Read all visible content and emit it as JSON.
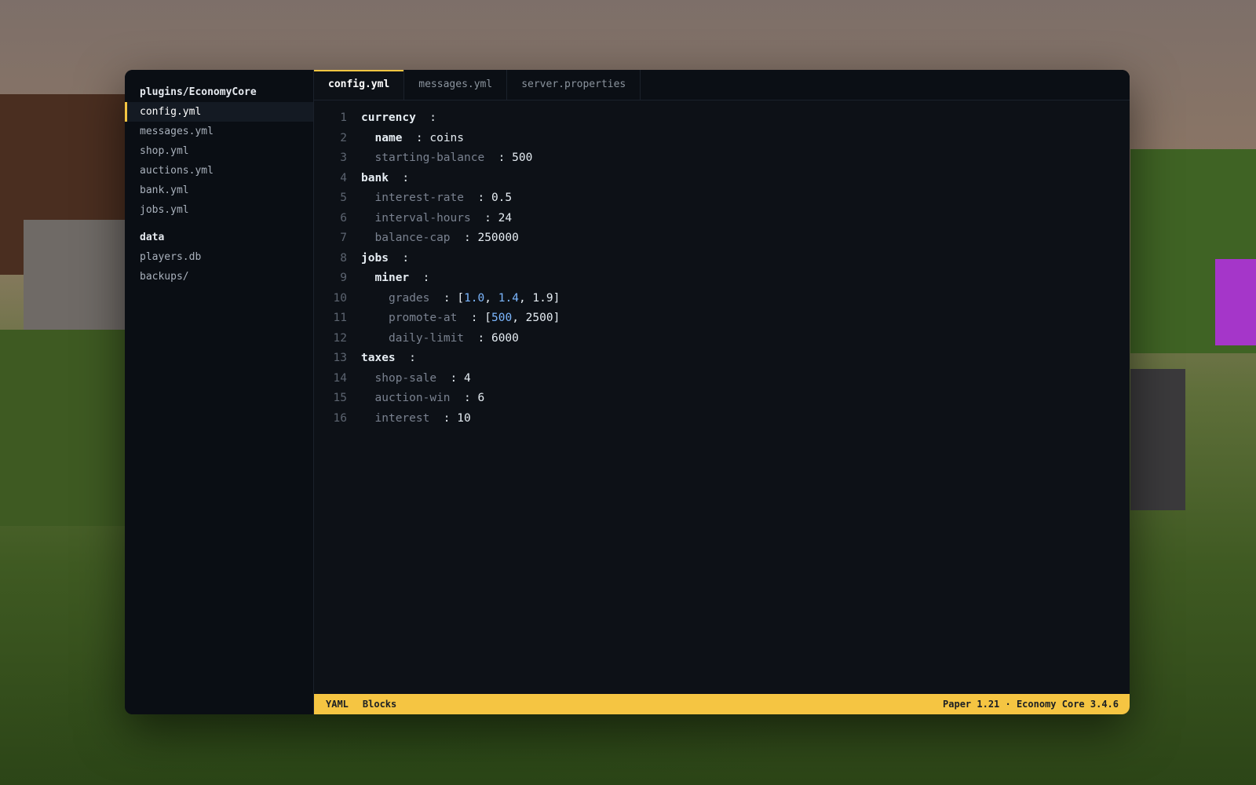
{
  "sidebar": {
    "groups": [
      {
        "title": "plugins/EconomyCore",
        "items": [
          "config.yml",
          "messages.yml",
          "shop.yml",
          "auctions.yml",
          "bank.yml",
          "jobs.yml"
        ]
      },
      {
        "title": "data",
        "items": [
          "players.db",
          "backups/"
        ]
      }
    ]
  },
  "tabs": [
    "config.yml",
    "messages.yml",
    "server.properties"
  ],
  "editor": {
    "language": "YAML",
    "lines": [
      {
        "n": "1",
        "key": "currency",
        "sep": "  :",
        "value": ""
      },
      {
        "n": "2",
        "key": "name",
        "sep": "  :",
        "value": "coins"
      },
      {
        "n": "3",
        "key": "starting-balance",
        "sep": "  :",
        "value": "500"
      },
      {
        "n": "4",
        "key": "bank",
        "sep": "  :",
        "value": ""
      },
      {
        "n": "5",
        "key": "interest-rate",
        "sep": "  :",
        "value": "0.5"
      },
      {
        "n": "6",
        "key": "interval-hours",
        "sep": "  :",
        "value": "24"
      },
      {
        "n": "7",
        "key": "balance-cap",
        "sep": "  :",
        "value": "250000"
      },
      {
        "n": "8",
        "key": "jobs",
        "sep": "  :",
        "value": ""
      },
      {
        "n": "9",
        "key": "miner",
        "sep": "  :",
        "value": ""
      },
      {
        "n": "10",
        "key": "grades",
        "sep": "  :",
        "list": [
          "1.0",
          "1.4",
          "1.9"
        ]
      },
      {
        "n": "11",
        "key": "promote-at",
        "sep": "  :",
        "list": [
          "500",
          "2500"
        ]
      },
      {
        "n": "12",
        "key": "daily-limit",
        "sep": "  :",
        "value": "6000"
      },
      {
        "n": "13",
        "key": "taxes",
        "sep": "  :",
        "value": ""
      },
      {
        "n": "14",
        "key": "shop-sale",
        "sep": "  :",
        "value": "4"
      },
      {
        "n": "15",
        "key": "auction-win",
        "sep": "  :",
        "value": "6"
      },
      {
        "n": "16",
        "key": "interest",
        "sep": "  :",
        "value": "10"
      }
    ]
  },
  "status": {
    "left": [
      "YAML",
      "Blocks"
    ],
    "right": "Paper 1.21 · Economy Core 3.4.6"
  },
  "colors": {
    "accent": "#f5c542",
    "editor_bg": "#0d1117",
    "number": "#7cb7ff"
  }
}
